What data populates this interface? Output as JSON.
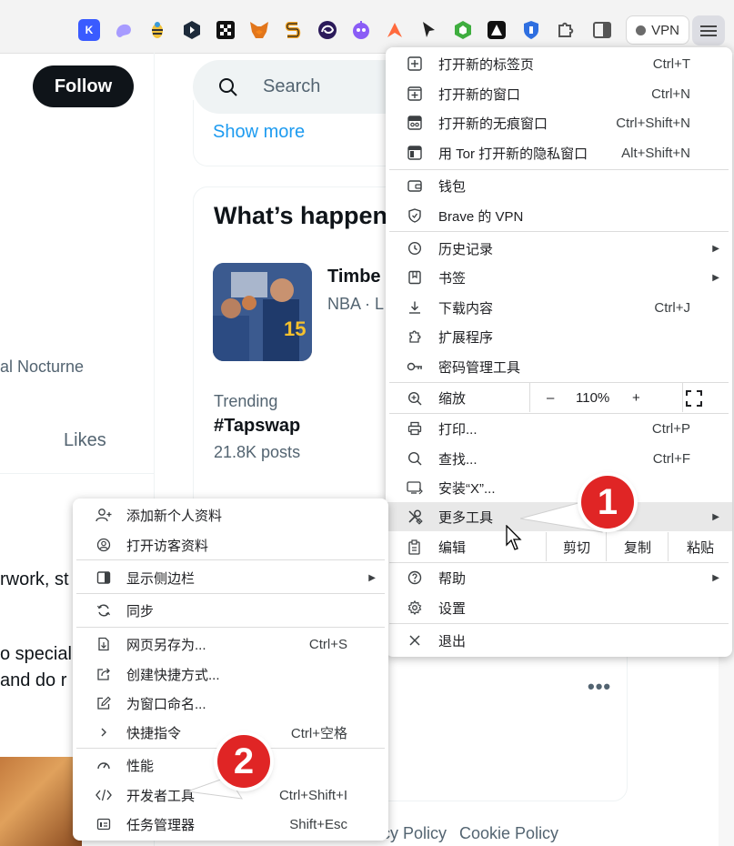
{
  "toolbar": {
    "extensions": [
      {
        "icon": "k-extension-icon",
        "label": "K",
        "color": "#3a5bff"
      },
      {
        "icon": "ghost-extension-icon",
        "label": "",
        "color": "#a79bff"
      },
      {
        "icon": "bee-extension-icon",
        "label": "",
        "color": "#f2c23a"
      },
      {
        "icon": "hex-extension-icon",
        "label": "",
        "color": "#1d2a3a"
      },
      {
        "icon": "okx-extension-icon",
        "label": "",
        "color": "#111111"
      },
      {
        "icon": "fox-extension-icon",
        "label": "",
        "color": "#e2761b"
      },
      {
        "icon": "s-extension-icon",
        "label": "",
        "color": "#f0a020"
      },
      {
        "icon": "swirl-extension-icon",
        "label": "",
        "color": "#2b1a5a"
      },
      {
        "icon": "robot-extension-icon",
        "label": "",
        "color": "#8a5cf6"
      },
      {
        "icon": "spark-extension-icon",
        "label": "",
        "color": "#ff6a3d"
      },
      {
        "icon": "pointer-extension-icon",
        "label": "",
        "color": "#222222"
      },
      {
        "icon": "cube-extension-icon",
        "label": "",
        "color": "#3fae3f"
      },
      {
        "icon": "arch-extension-icon",
        "label": "",
        "color": "#111111"
      },
      {
        "icon": "shield-extension-icon",
        "label": "",
        "color": "#2f6fe0"
      },
      {
        "icon": "puzzle-icon",
        "label": "",
        "color": "#555555"
      },
      {
        "icon": "sidebar-icon",
        "label": "",
        "color": "#555555"
      }
    ],
    "vpn_label": "VPN"
  },
  "page": {
    "follow_label": "Follow",
    "search_placeholder": "Search",
    "show_more": "Show more",
    "whats_happening": "What’s happen",
    "trend1_title": "Timbe",
    "trend1_sub": "NBA · L",
    "trend2_label": "Trending",
    "trend2_title": "#Tapswap",
    "trend2_count": "21.8K posts",
    "profile_text": "al Nocturne",
    "likes_tab": "Likes",
    "post_line1": "rwork, st",
    "post_line2": "o special",
    "post_line3": " and do r",
    "more_dots": "•••",
    "footer": [
      "cy Policy",
      "Cookie Policy"
    ]
  },
  "main_menu": {
    "items": [
      {
        "icon": "new-tab-icon",
        "label": "打开新的标签页",
        "shortcut": "Ctrl+T"
      },
      {
        "icon": "new-window-icon",
        "label": "打开新的窗口",
        "shortcut": "Ctrl+N"
      },
      {
        "icon": "private-window-icon",
        "label": "打开新的无痕窗口",
        "shortcut": "Ctrl+Shift+N"
      },
      {
        "icon": "tor-window-icon",
        "label": "用 Tor 打开新的隐私窗口",
        "shortcut": "Alt+Shift+N"
      },
      {
        "icon": "wallet-icon",
        "label": "钱包",
        "shortcut": ""
      },
      {
        "icon": "vpn-shield-icon",
        "label": "Brave 的 VPN",
        "shortcut": ""
      },
      {
        "icon": "history-icon",
        "label": "历史记录",
        "shortcut": ""
      },
      {
        "icon": "bookmark-icon",
        "label": "书签",
        "shortcut": ""
      },
      {
        "icon": "download-icon",
        "label": "下载内容",
        "shortcut": "Ctrl+J"
      },
      {
        "icon": "extensions-icon",
        "label": "扩展程序",
        "shortcut": ""
      },
      {
        "icon": "key-icon",
        "label": "密码管理工具",
        "shortcut": ""
      },
      {
        "icon": "print-icon",
        "label": "打印...",
        "shortcut": "Ctrl+P"
      },
      {
        "icon": "find-icon",
        "label": "查找...",
        "shortcut": "Ctrl+F"
      },
      {
        "icon": "install-icon",
        "label": "安装“X”...",
        "shortcut": ""
      },
      {
        "icon": "tools-icon",
        "label": "更多工具",
        "shortcut": ""
      },
      {
        "icon": "help-icon",
        "label": "帮助",
        "shortcut": ""
      },
      {
        "icon": "settings-icon",
        "label": "设置",
        "shortcut": ""
      },
      {
        "icon": "exit-icon",
        "label": "退出",
        "shortcut": ""
      }
    ],
    "zoom": {
      "label": "缩放",
      "minus": "–",
      "value": "110%",
      "plus": "+"
    },
    "edit": {
      "label": "编辑",
      "cut": "剪切",
      "copy": "复制",
      "paste": "粘贴"
    }
  },
  "sub_menu": {
    "items": [
      {
        "icon": "add-profile-icon",
        "label": "添加新个人资料",
        "shortcut": ""
      },
      {
        "icon": "guest-profile-icon",
        "label": "打开访客资料",
        "shortcut": ""
      },
      {
        "icon": "show-sidebar-icon",
        "label": "显示侧边栏",
        "shortcut": ""
      },
      {
        "icon": "sync-icon",
        "label": "同步",
        "shortcut": ""
      },
      {
        "icon": "save-page-icon",
        "label": "网页另存为...",
        "shortcut": "Ctrl+S"
      },
      {
        "icon": "create-shortcut-icon",
        "label": "创建快捷方式...",
        "shortcut": ""
      },
      {
        "icon": "rename-window-icon",
        "label": "为窗口命名...",
        "shortcut": ""
      },
      {
        "icon": "chevron-right-icon",
        "label": "快捷指令",
        "shortcut": "Ctrl+空格"
      },
      {
        "icon": "performance-icon",
        "label": "性能",
        "shortcut": ""
      },
      {
        "icon": "developer-tools-icon",
        "label": "开发者工具",
        "shortcut": "Ctrl+Shift+I"
      },
      {
        "icon": "task-manager-icon",
        "label": "任务管理器",
        "shortcut": "Shift+Esc"
      }
    ]
  },
  "annotations": {
    "badge1": "1",
    "badge2": "2"
  }
}
